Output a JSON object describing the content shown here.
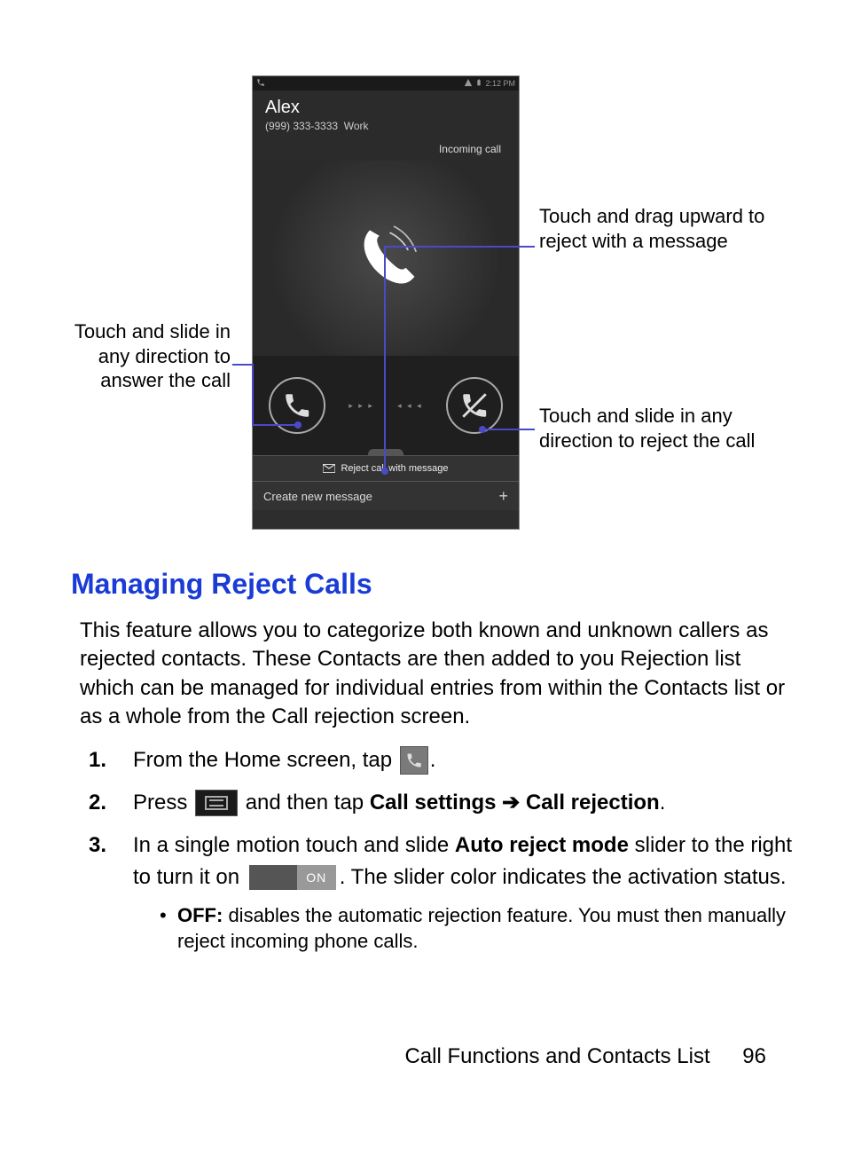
{
  "screenshot": {
    "status_time": "2:12 PM",
    "caller_name": "Alex",
    "caller_number": "(999) 333-3333",
    "caller_type": "Work",
    "incoming_label": "Incoming call",
    "reject_msg_label": "Reject call with message",
    "create_msg_label": "Create new message"
  },
  "callouts": {
    "left": "Touch and slide in any direction to answer the call",
    "right_top": "Touch and drag upward to reject with a message",
    "right_bottom": "Touch and slide in any direction to reject the call"
  },
  "heading": "Managing Reject Calls",
  "paragraph": "This feature allows you to categorize both known and unknown callers as rejected contacts. These Contacts are then added to you Rejection list which can be managed for individual entries from within the Contacts list or as a whole from the Call rejection screen.",
  "steps": {
    "n1": "1.",
    "t1a": "From the Home screen, tap ",
    "t1b": ".",
    "n2": "2.",
    "t2a": "Press ",
    "t2b": " and then tap ",
    "t2c": "Call settings",
    "t2d": " ➔ ",
    "t2e": "Call rejection",
    "t2f": ".",
    "n3": "3.",
    "t3a": "In a single motion touch and slide ",
    "t3b": "Auto reject mode",
    "t3c": " slider to the right to turn it on ",
    "t3d": ". The slider color indicates the activation status.",
    "slider_on": "ON",
    "bullet_label": "OFF:",
    "bullet_text": " disables the automatic rejection feature. You must then manually reject incoming phone calls."
  },
  "footer": {
    "section": "Call Functions and Contacts List",
    "page": "96"
  }
}
